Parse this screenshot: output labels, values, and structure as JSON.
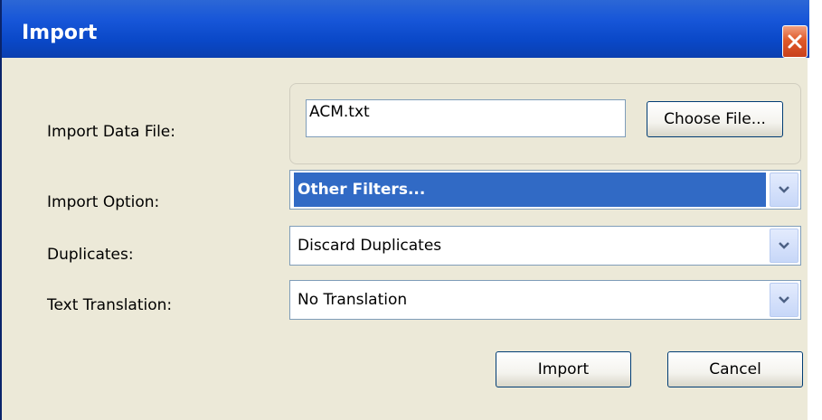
{
  "window": {
    "title": "Import"
  },
  "form": {
    "import_data_file_label": "Import Data File:",
    "file_value": "ACM.txt",
    "choose_file_label": "Choose File...",
    "import_option_label": "Import Option:",
    "import_option_value": "Other Filters...",
    "duplicates_label": "Duplicates:",
    "duplicates_value": "Discard Duplicates",
    "text_translation_label": "Text Translation:",
    "text_translation_value": "No Translation"
  },
  "buttons": {
    "import_label": "Import",
    "cancel_label": "Cancel"
  },
  "icons": {
    "close": "close-icon",
    "dropdown": "chevron-down-icon"
  },
  "colors": {
    "titlebar": "#0a48c8",
    "selection": "#316ac5",
    "close": "#e05a2a"
  }
}
